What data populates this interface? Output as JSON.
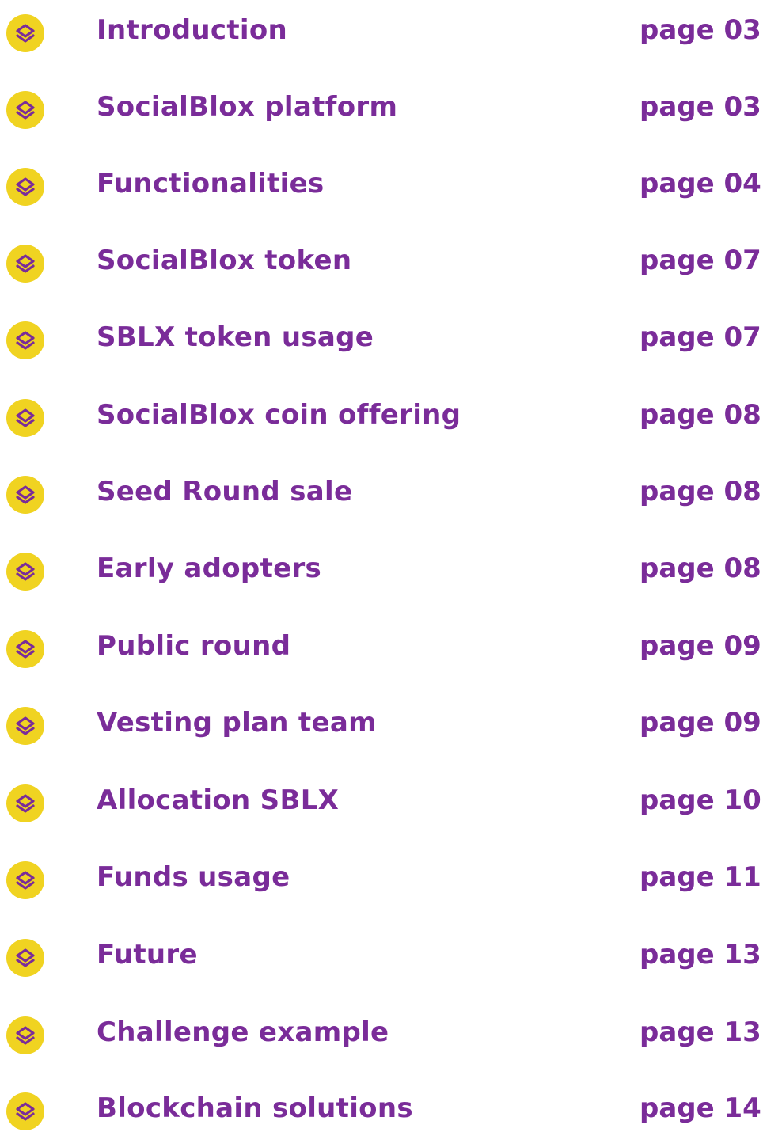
{
  "toc": {
    "prefix": "page",
    "accent_color": "#7a2c99",
    "bullet_color": "#f0d321",
    "bullet_icon": "socialblox-logo-icon",
    "items": [
      {
        "title": "Introduction",
        "page": "page 03"
      },
      {
        "title": "SocialBlox platform",
        "page": "page 03"
      },
      {
        "title": "Functionalities",
        "page": "page 04"
      },
      {
        "title": "SocialBlox token",
        "page": "page 07"
      },
      {
        "title": "SBLX token usage",
        "page": "page 07"
      },
      {
        "title": "SocialBlox coin offering",
        "page": "page 08"
      },
      {
        "title": "Seed Round sale",
        "page": "page 08"
      },
      {
        "title": "Early adopters",
        "page": "page 08"
      },
      {
        "title": "Public round",
        "page": "page 09"
      },
      {
        "title": "Vesting plan team",
        "page": "page 09"
      },
      {
        "title": "Allocation SBLX",
        "page": "page 10"
      },
      {
        "title": "Funds usage",
        "page": "page 11"
      },
      {
        "title": "Future",
        "page": "page 13"
      },
      {
        "title": "Challenge example",
        "page": "page 13"
      },
      {
        "title": "Blockchain solutions",
        "page": "page 14"
      }
    ]
  }
}
